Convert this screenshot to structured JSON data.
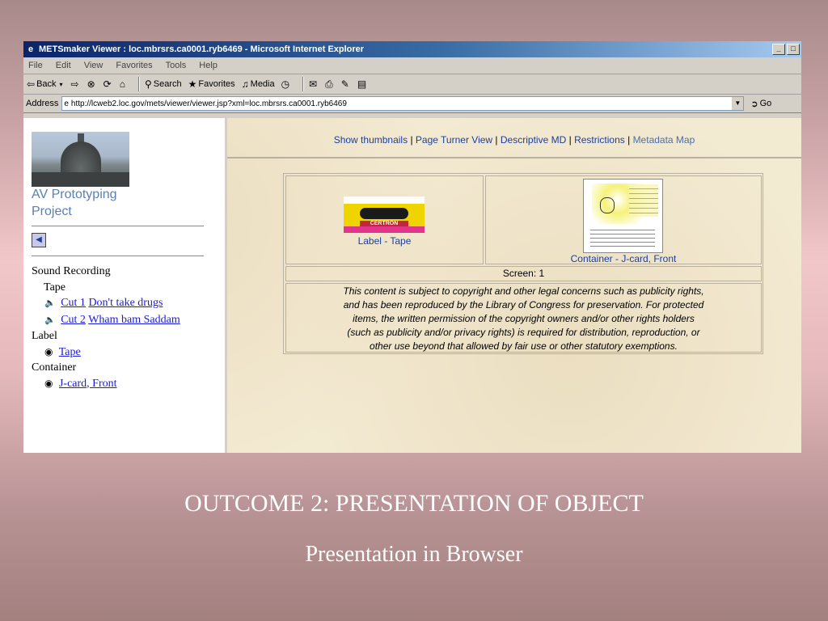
{
  "window": {
    "title": "METSmaker Viewer : loc.mbrsrs.ca0001.ryb6469 - Microsoft Internet Explorer"
  },
  "menu": [
    "File",
    "Edit",
    "View",
    "Favorites",
    "Tools",
    "Help"
  ],
  "toolbar": {
    "back": "Back",
    "search": "Search",
    "favorites": "Favorites",
    "media": "Media"
  },
  "address": {
    "label": "Address",
    "url": "http://lcweb2.loc.gov/mets/viewer/viewer.jsp?xml=loc.mbrsrs.ca0001.ryb6469",
    "go": "Go"
  },
  "sidebar": {
    "project_line1": "AV Prototyping",
    "project_line2": "Project",
    "tree": {
      "sound_recording": "Sound Recording",
      "tape": "Tape",
      "cut1_num": "Cut 1",
      "cut1_title": "Don't take drugs",
      "cut2_num": "Cut 2",
      "cut2_title": "Wham bam Saddam",
      "label": "Label",
      "label_tape": "Tape",
      "container": "Container",
      "container_jcard": "J-card, Front"
    }
  },
  "nav": {
    "show_thumbnails": "Show thumbnails",
    "page_turner": "Page Turner View",
    "descriptive_md": "Descriptive MD",
    "restrictions": "Restrictions",
    "metadata_map": "Metadata Map",
    "sep": "|"
  },
  "viewer": {
    "thumb1_caption": "Label - Tape",
    "thumb2_caption": "Container - J-card, Front",
    "tape_brand": "CERTRON",
    "screen_label": "Screen: 1",
    "notice": [
      "This content is subject to copyright and other legal concerns such as publicity rights,",
      "and has been reproduced by the Library of Congress for preservation. For protected",
      "items, the written permission of the copyright owners and/or other rights holders",
      "(such as publicity and/or privacy rights) is required for distribution, reproduction, or",
      "other use beyond that allowed by fair use or other statutory exemptions."
    ]
  },
  "slide": {
    "title": "OUTCOME 2: PRESENTATION OF OBJECT",
    "subtitle": "Presentation in Browser"
  }
}
